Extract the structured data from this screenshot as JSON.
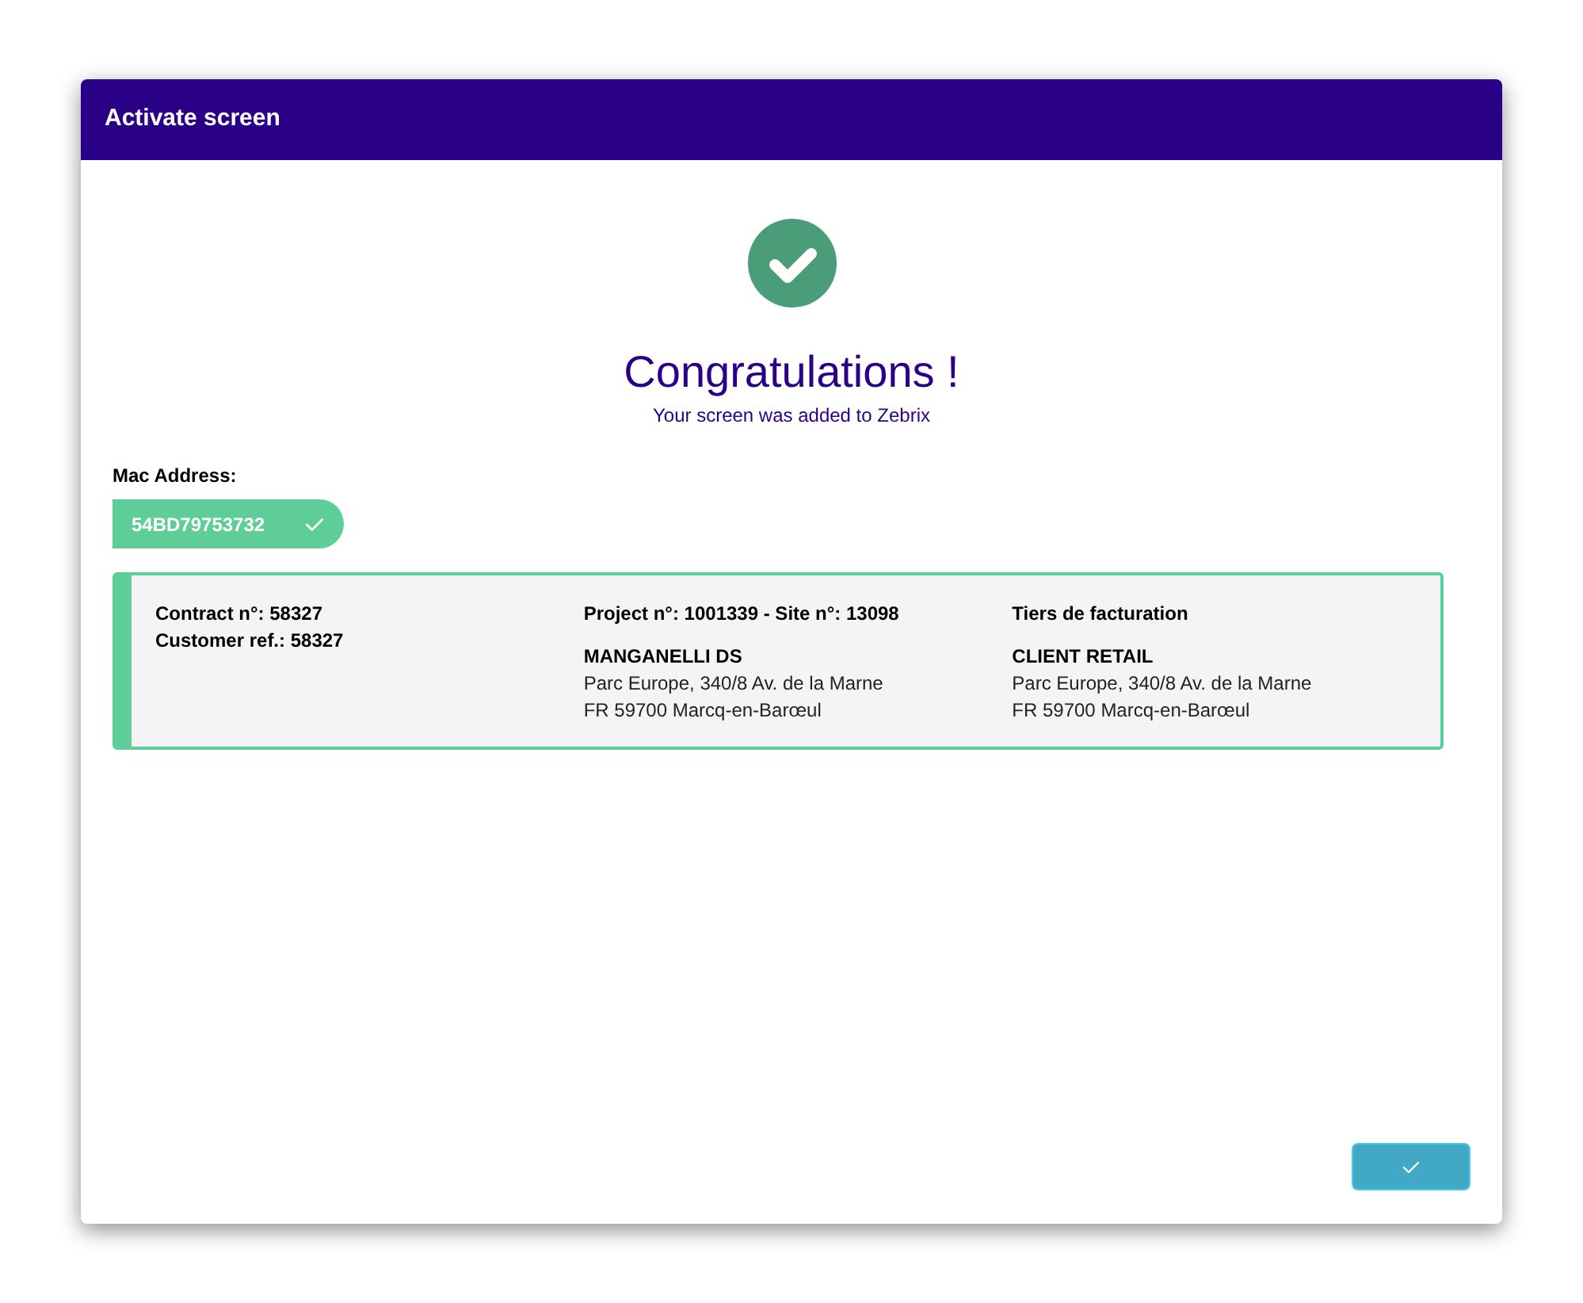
{
  "window": {
    "title": "Activate screen"
  },
  "success": {
    "heading": "Congratulations !",
    "message": "Your screen was added to Zebrix"
  },
  "mac": {
    "label": "Mac Address:",
    "value": "54BD79753732"
  },
  "contract": {
    "lines": [
      "Contract n°: 58327",
      "Customer ref.: 58327"
    ]
  },
  "project": {
    "title": "Project n°: 1001339 - Site n°: 13098",
    "name": "MANGANELLI DS",
    "address": [
      "Parc Europe, 340/8 Av. de la Marne",
      "FR 59700 Marcq-en-Barœul"
    ]
  },
  "billing": {
    "title": "Tiers de facturation",
    "name": "CLIENT RETAIL",
    "address": [
      "Parc Europe, 340/8 Av. de la Marne",
      "FR 59700 Marcq-en-Barœul"
    ]
  }
}
